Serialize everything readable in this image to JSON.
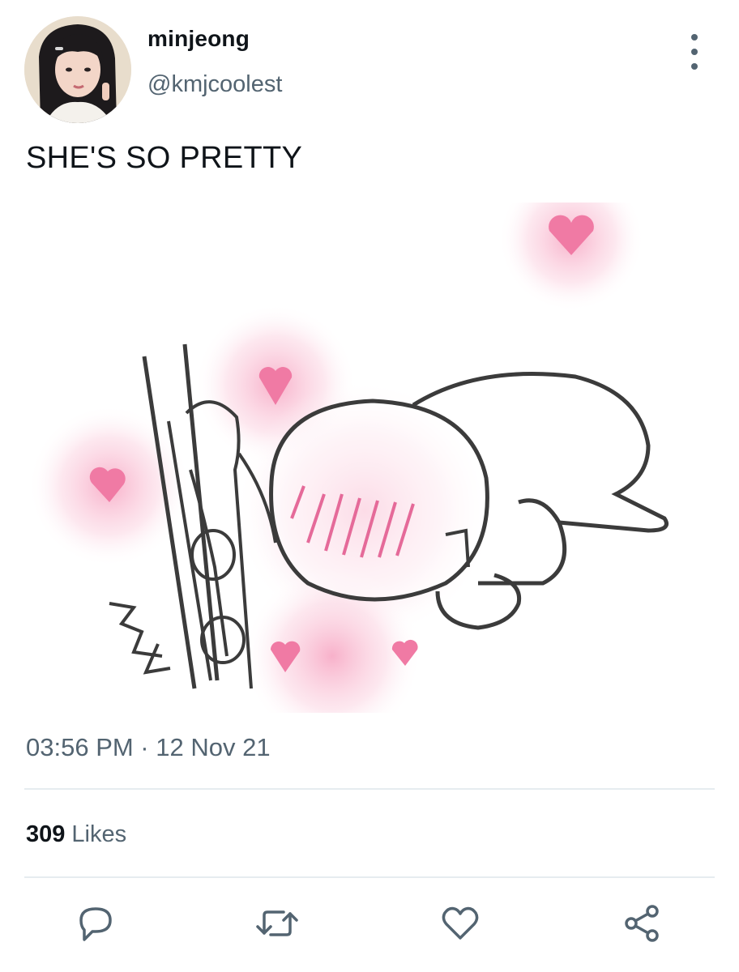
{
  "tweet": {
    "user": {
      "display_name": "minjeong",
      "handle": "@kmjcoolest",
      "avatar_icon": "profile-photo"
    },
    "text": "SHE'S SO PRETTY",
    "media": {
      "icon": "cartoon-hearts-drawing",
      "heart_color": "#f07aa4"
    },
    "timestamp": "03:56 PM · 12 Nov 21",
    "likes": {
      "count": "309",
      "label": "Likes"
    },
    "actions": {
      "reply_icon": "reply-icon",
      "retweet_icon": "retweet-icon",
      "like_icon": "heart-icon",
      "share_icon": "share-icon"
    },
    "colors": {
      "primary_text": "#0f1419",
      "secondary_text": "#536471",
      "divider": "#e6ecf0"
    }
  }
}
